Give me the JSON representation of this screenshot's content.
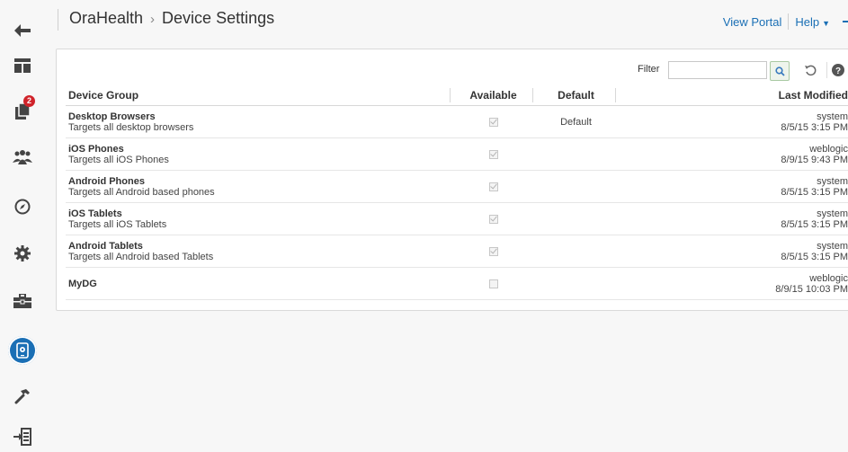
{
  "header": {
    "app_name": "OraHealth",
    "separator": "›",
    "page_title": "Device Settings",
    "view_portal": "View Portal",
    "help": "Help"
  },
  "rail": {
    "items": [
      {
        "name": "back",
        "icon": "back-arrow-icon"
      },
      {
        "name": "pages",
        "icon": "page-layout-icon"
      },
      {
        "name": "content",
        "icon": "documents-icon",
        "badge": "2"
      },
      {
        "name": "people",
        "icon": "people-icon"
      },
      {
        "name": "navigation",
        "icon": "compass-icon"
      },
      {
        "name": "settings",
        "icon": "gear-icon"
      },
      {
        "name": "resources",
        "icon": "toolbox-icon"
      },
      {
        "name": "device-settings",
        "icon": "device-settings-icon",
        "active": true
      },
      {
        "name": "build",
        "icon": "hammer-icon"
      },
      {
        "name": "import-export",
        "icon": "import-export-icon"
      }
    ]
  },
  "filter": {
    "label": "Filter",
    "value": ""
  },
  "table": {
    "columns": {
      "device_group": "Device Group",
      "available": "Available",
      "default": "Default",
      "last_modified": "Last Modified"
    },
    "rows": [
      {
        "name": "Desktop Browsers",
        "desc": "Targets all desktop browsers",
        "available": true,
        "default": "Default",
        "user": "system",
        "date": "8/5/15 3:15 PM"
      },
      {
        "name": "iOS Phones",
        "desc": "Targets all iOS Phones",
        "available": true,
        "default": "",
        "user": "weblogic",
        "date": "8/9/15 9:43 PM"
      },
      {
        "name": "Android Phones",
        "desc": "Targets all Android based phones",
        "available": true,
        "default": "",
        "user": "system",
        "date": "8/5/15 3:15 PM"
      },
      {
        "name": "iOS Tablets",
        "desc": "Targets all iOS Tablets",
        "available": true,
        "default": "",
        "user": "system",
        "date": "8/5/15 3:15 PM"
      },
      {
        "name": "Android Tablets",
        "desc": "Targets all Android based Tablets",
        "available": true,
        "default": "",
        "user": "system",
        "date": "8/5/15 3:15 PM"
      },
      {
        "name": "MyDG",
        "desc": "",
        "available": false,
        "default": "",
        "user": "weblogic",
        "date": "8/9/15 10:03 PM"
      }
    ]
  },
  "colors": {
    "accent": "#1a6fb5",
    "badge": "#d0232a"
  }
}
